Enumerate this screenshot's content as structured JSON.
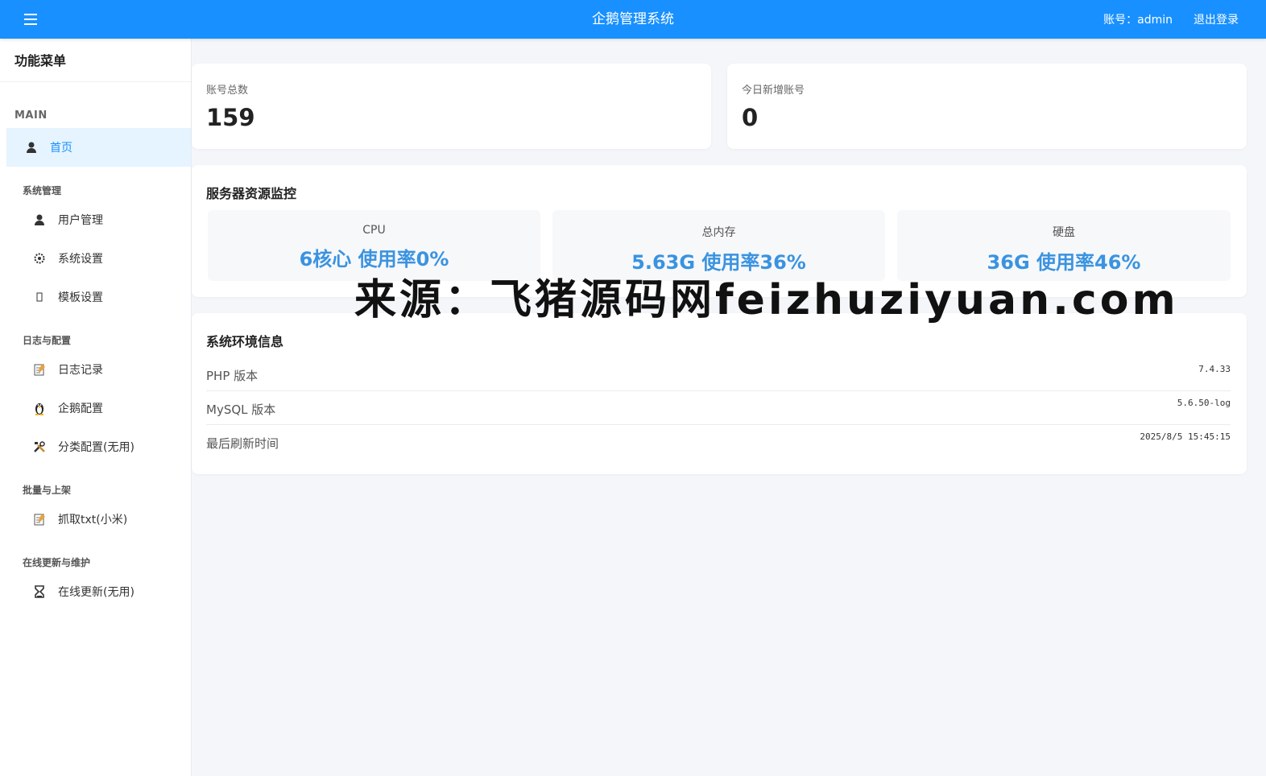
{
  "header": {
    "app_title": "企鹅管理系统",
    "account": "账号：admin",
    "logout": "退出登录"
  },
  "sidebar": {
    "title": "功能菜单",
    "main_label": "MAIN",
    "home": {
      "label": "首页",
      "icon": "user-icon"
    },
    "sections": [
      {
        "label": "系统管理",
        "items": [
          {
            "label": "用户管理",
            "icon": "user-icon"
          },
          {
            "label": "系统设置",
            "icon": "gear-icon"
          },
          {
            "label": "模板设置",
            "icon": "template-icon"
          }
        ]
      },
      {
        "label": "日志与配置",
        "items": [
          {
            "label": "日志记录",
            "icon": "memo-icon"
          },
          {
            "label": "企鹅配置",
            "icon": "penguin-icon"
          },
          {
            "label": "分类配置(无用)",
            "icon": "tools-icon"
          }
        ]
      },
      {
        "label": "批量与上架",
        "items": [
          {
            "label": "抓取txt(小米)",
            "icon": "memo-icon"
          }
        ]
      },
      {
        "label": "在线更新与维护",
        "items": [
          {
            "label": "在线更新(无用)",
            "icon": "update-icon"
          }
        ]
      }
    ]
  },
  "stats": {
    "total_accounts_label": "账号总数",
    "total_accounts_value": "159",
    "new_today_label": "今日新增账号",
    "new_today_value": "0"
  },
  "server_monitor": {
    "title": "服务器资源监控",
    "cpu_label": "CPU",
    "cpu_value": "6核心 使用率0%",
    "mem_label": "总内存",
    "mem_value": "5.63G 使用率36%",
    "disk_label": "硬盘",
    "disk_value": "36G 使用率46%",
    "accent_color": "#3a93e0"
  },
  "env_info": {
    "title": "系统环境信息",
    "rows": [
      {
        "key": "PHP 版本",
        "value": "7.4.33"
      },
      {
        "key": "MySQL 版本",
        "value": "5.6.50-log"
      },
      {
        "key": "最后刷新时间",
        "value": "2025/8/5 15:45:15"
      }
    ]
  },
  "watermark": "来源：飞猪源码网feizhuziyuan.com",
  "colors": {
    "header": "#1890ff",
    "active_bg": "#e6f4ff",
    "background": "#f4f6fa"
  }
}
